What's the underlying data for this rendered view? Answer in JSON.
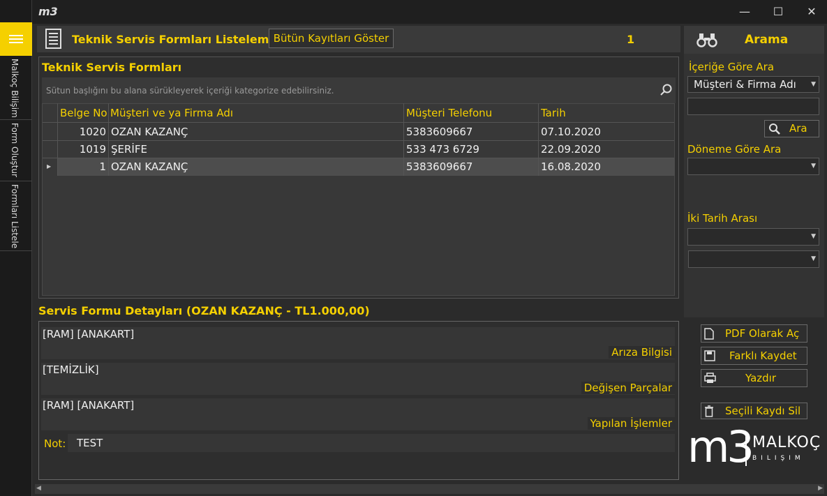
{
  "app": {
    "logo_text": "m3"
  },
  "sidebar": {
    "items": [
      {
        "label": "Malkoç Bilişim"
      },
      {
        "label": "Form Oluştur"
      },
      {
        "label": "Formları Listele"
      }
    ]
  },
  "window": {
    "minimize": "—",
    "maximize": "☐",
    "close": "✕"
  },
  "header": {
    "title": "Teknik Servis Formları Listeleme",
    "show_all_button": "Bütün Kayıtları Göster",
    "count": "1"
  },
  "grid": {
    "title": "Teknik Servis Formları",
    "group_hint": "Sütun başlığını bu alana sürükleyerek içeriği kategorize edebilirsiniz.",
    "columns": [
      "Belge No",
      "Müşteri ve ya Firma Adı",
      "Müşteri Telefonu",
      "Tarih"
    ],
    "rows": [
      [
        "1020",
        "OZAN KAZANÇ",
        "5383609667",
        "07.10.2020"
      ],
      [
        "1019",
        "ŞERİFE",
        "533 473 6729",
        "22.09.2020"
      ],
      [
        "1",
        "OZAN KAZANÇ",
        "5383609667",
        "16.08.2020"
      ]
    ],
    "selected_row": 2
  },
  "detail": {
    "title": "Servis Formu Detayları (OZAN KAZANÇ - TL1.000,00)",
    "ariza_value": "[RAM] [ANAKART]",
    "ariza_label": "Arıza Bilgisi",
    "parca_value": "[TEMİZLİK]",
    "parca_label": "Değişen Parçalar",
    "islem_value": "[RAM] [ANAKART]",
    "islem_label": "Yapılan İşlemler",
    "not_label": "Not:",
    "not_value": "TEST"
  },
  "search": {
    "title": "Arama",
    "content_label": "İçeriğe Göre Ara",
    "content_select": "Müşteri & Firma Adı",
    "search_input": "",
    "search_button": "Ara",
    "period_label": "Döneme Göre Ara",
    "period_select": "",
    "range_label": "İki Tarih Arası",
    "date_from": "",
    "date_to": ""
  },
  "actions": {
    "pdf": "PDF Olarak Aç",
    "save_as": "Farklı Kaydet",
    "print": "Yazdır",
    "delete": "Seçili Kaydı Sil"
  },
  "brand": {
    "name": "MALKOÇ",
    "sub": "BILIŞIM",
    "logo": "m3"
  },
  "colors": {
    "accent": "#f5d000",
    "background": "#2b2b2b"
  }
}
